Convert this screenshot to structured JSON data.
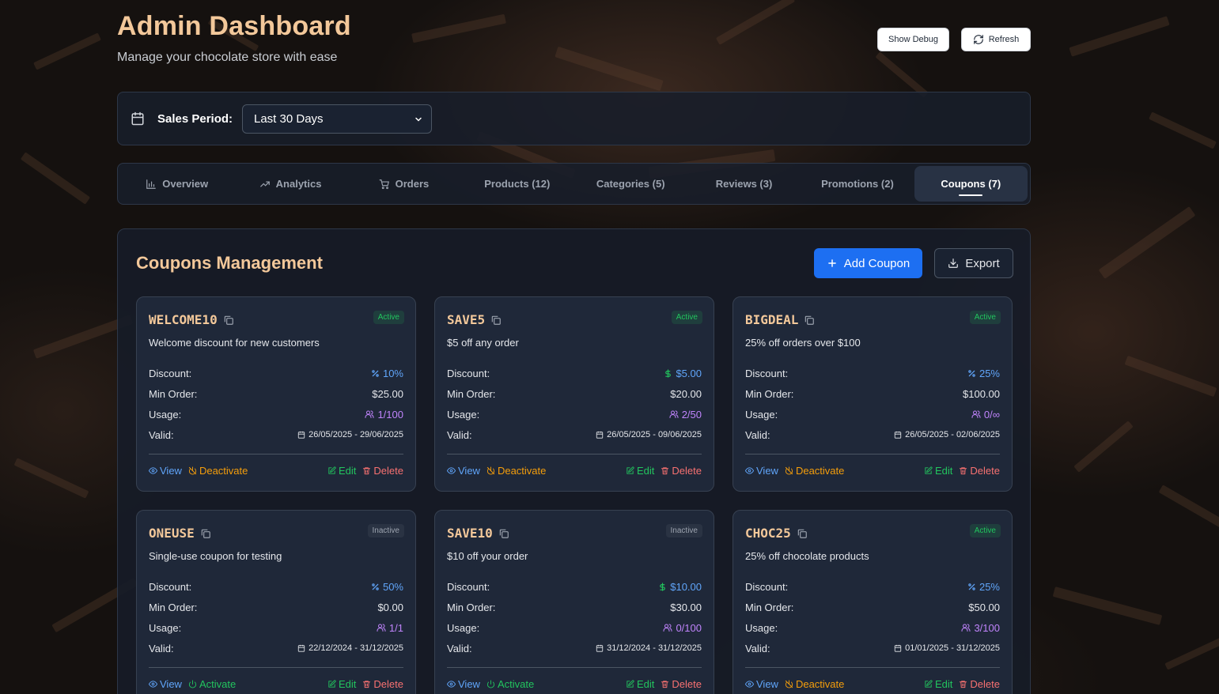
{
  "header": {
    "title": "Admin Dashboard",
    "subtitle": "Manage your chocolate store with ease",
    "show_debug_label": "Show Debug",
    "refresh_label": "Refresh"
  },
  "sales_period": {
    "label": "Sales Period:",
    "selected": "Last 30 Days"
  },
  "tabs": [
    {
      "label": "Overview",
      "icon": "bar-chart-icon"
    },
    {
      "label": "Analytics",
      "icon": "trending-up-icon"
    },
    {
      "label": "Orders",
      "icon": "cart-icon"
    },
    {
      "label": "Products (12)"
    },
    {
      "label": "Categories (5)"
    },
    {
      "label": "Reviews (3)"
    },
    {
      "label": "Promotions (2)"
    },
    {
      "label": "Coupons (7)",
      "active": true
    }
  ],
  "coupons_panel": {
    "title": "Coupons Management",
    "add_label": "Add Coupon",
    "export_label": "Export",
    "field_labels": {
      "discount": "Discount:",
      "min_order": "Min Order:",
      "usage": "Usage:",
      "valid": "Valid:"
    },
    "action_labels": {
      "view": "View",
      "edit": "Edit",
      "delete": "Delete"
    },
    "coupons": [
      {
        "code": "WELCOME10",
        "status": "Active",
        "description": "Welcome discount for new customers",
        "discount": "10%",
        "discount_type": "percent",
        "min_order": "$25.00",
        "usage": "1/100",
        "valid": "26/05/2025 - 29/06/2025",
        "toggle": "Deactivate"
      },
      {
        "code": "SAVE5",
        "status": "Active",
        "description": "$5 off any order",
        "discount": "$5.00",
        "discount_type": "fixed",
        "min_order": "$20.00",
        "usage": "2/50",
        "valid": "26/05/2025 - 09/06/2025",
        "toggle": "Deactivate"
      },
      {
        "code": "BIGDEAL",
        "status": "Active",
        "description": "25% off orders over $100",
        "discount": "25%",
        "discount_type": "percent",
        "min_order": "$100.00",
        "usage": "0/∞",
        "valid": "26/05/2025 - 02/06/2025",
        "toggle": "Deactivate"
      },
      {
        "code": "ONEUSE",
        "status": "Inactive",
        "description": "Single-use coupon for testing",
        "discount": "50%",
        "discount_type": "percent",
        "min_order": "$0.00",
        "usage": "1/1",
        "valid": "22/12/2024 - 31/12/2025",
        "toggle": "Activate"
      },
      {
        "code": "SAVE10",
        "status": "Inactive",
        "description": "$10 off your order",
        "discount": "$10.00",
        "discount_type": "fixed",
        "min_order": "$30.00",
        "usage": "0/100",
        "valid": "31/12/2024 - 31/12/2025",
        "toggle": "Activate"
      },
      {
        "code": "CHOC25",
        "status": "Active",
        "description": "25% off chocolate products",
        "discount": "25%",
        "discount_type": "percent",
        "min_order": "$50.00",
        "usage": "3/100",
        "valid": "01/01/2025 - 31/12/2025",
        "toggle": "Deactivate"
      }
    ]
  },
  "colors": {
    "accent_title": "#f3c89a",
    "primary_button": "#1d6ff2",
    "active_badge": "#22c55e",
    "view": "#60a5fa",
    "deactivate": "#f59e0b",
    "delete": "#f87171",
    "usage": "#c084fc"
  }
}
